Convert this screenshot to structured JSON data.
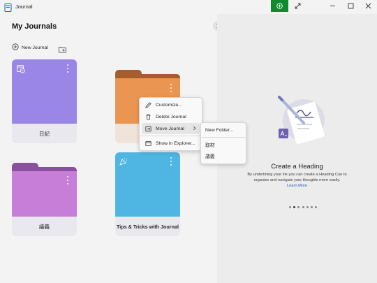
{
  "window": {
    "title": "Journal"
  },
  "left": {
    "heading": "My Journals",
    "new_journal": "New Journal",
    "cards": [
      {
        "label": "日記",
        "color": "#9a86e6"
      },
      {
        "label": "",
        "color": "#eb9553"
      },
      {
        "label": "議義",
        "color": "#c77ed8"
      },
      {
        "label": "Tips & Tricks with Journal",
        "color": "#4fb5e3"
      }
    ]
  },
  "context_menu": {
    "items": [
      "Customize...",
      "Delete Journal",
      "Move Journal",
      "Show in Explorer..."
    ]
  },
  "submenu": {
    "items": [
      "New Folder...",
      "取材",
      "議義"
    ]
  },
  "right": {
    "heading": "Create a Heading",
    "description": "By underlining your ink you can create a Heading Cue to organize and navigate your thoughts more easily.",
    "link": "Learn More",
    "page_count": 7,
    "active_page": 2
  }
}
